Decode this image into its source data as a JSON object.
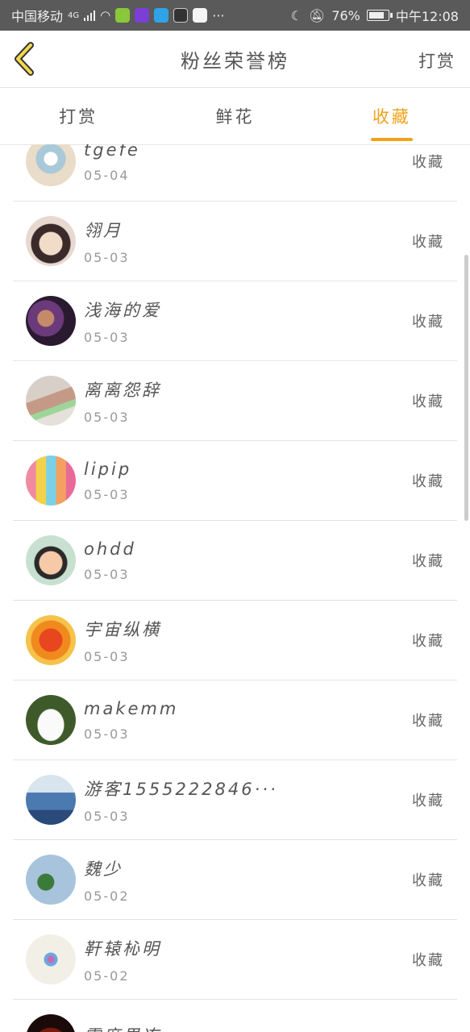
{
  "status_bar": {
    "carrier": "中国移动",
    "network": "4G",
    "battery": "76%",
    "time": "中午12:08",
    "more": "···"
  },
  "header": {
    "back_icon": "chevron-left-icon",
    "title": "粉丝荣誉榜",
    "right_label": "打赏"
  },
  "tabs": [
    {
      "label": "打赏",
      "active": false
    },
    {
      "label": "鲜花",
      "active": false
    },
    {
      "label": "收藏",
      "active": true
    }
  ],
  "accent_color": "#f0a21b",
  "fans": [
    {
      "name": "tgefe",
      "date": "05-04",
      "action": "收藏",
      "avatar": "flower-cup"
    },
    {
      "name": "翎月",
      "date": "05-03",
      "action": "收藏",
      "avatar": "anime-girl"
    },
    {
      "name": "浅海的爱",
      "date": "05-03",
      "action": "收藏",
      "avatar": "warrior-purple"
    },
    {
      "name": "离离怨辞",
      "date": "05-03",
      "action": "收藏",
      "avatar": "doll-girl"
    },
    {
      "name": "lipip",
      "date": "05-03",
      "action": "收藏",
      "avatar": "candy-colors"
    },
    {
      "name": "ohdd",
      "date": "05-03",
      "action": "收藏",
      "avatar": "cartoon-kid"
    },
    {
      "name": "宇宙纵横",
      "date": "05-03",
      "action": "收藏",
      "avatar": "orange-leaf"
    },
    {
      "name": "makemm",
      "date": "05-03",
      "action": "收藏",
      "avatar": "white-rabbit"
    },
    {
      "name": "游客1555222846···",
      "date": "05-03",
      "action": "收藏",
      "avatar": "sea-scene"
    },
    {
      "name": "魏少",
      "date": "05-02",
      "action": "收藏",
      "avatar": "green-clover"
    },
    {
      "name": "靬辕杺明",
      "date": "05-02",
      "action": "收藏",
      "avatar": "pastel-dots"
    },
    {
      "name": "零度果冻",
      "date": "",
      "action": "",
      "avatar": "dark-fire"
    }
  ]
}
